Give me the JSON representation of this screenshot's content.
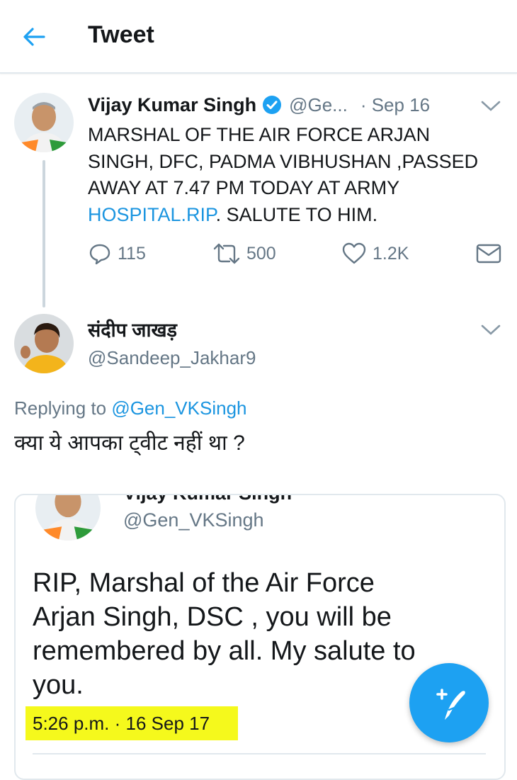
{
  "header": {
    "title": "Tweet",
    "back_icon": "arrow-left-icon"
  },
  "tweet": {
    "author_name": "Vijay Kumar Singh",
    "verified_icon": "verified-badge-icon",
    "handle": "@Ge...",
    "time": "· Sep 16",
    "text_lines": [
      "MARSHAL OF THE AIR FORCE ARJAN",
      "SINGH, DFC, PADMA VIBHUSHAN ,PASSED",
      "AWAY AT 7.47  PM  TODAY AT ARMY"
    ],
    "text_link": "HOSPITAL.RIP",
    "text_tail": ". SALUTE TO HIM.",
    "replies": "115",
    "retweets": "500",
    "likes": "1.2K"
  },
  "reply": {
    "author_name": "संदीप जाखड़",
    "handle": "@Sandeep_Jakhar9",
    "replying_prefix": "Replying to",
    "replying_handle": "@Gen_VKSingh",
    "text": "क्या ये आपका ट्वीट नहीं था ?"
  },
  "quoted": {
    "cut_name": "Vijay Kumar Singh",
    "handle": "@Gen_VKSingh",
    "text_lines": [
      "RIP, Marshal of the Air Force",
      "Arjan Singh, DSC , you will be",
      "remembered by all. My salute to",
      "you."
    ],
    "timestamp": "5:26 p.m. · 16 Sep 17"
  },
  "colors": {
    "accent": "#1da1f2",
    "link": "#1b95e0",
    "highlight": "#f5f91c",
    "muted": "#657786"
  }
}
